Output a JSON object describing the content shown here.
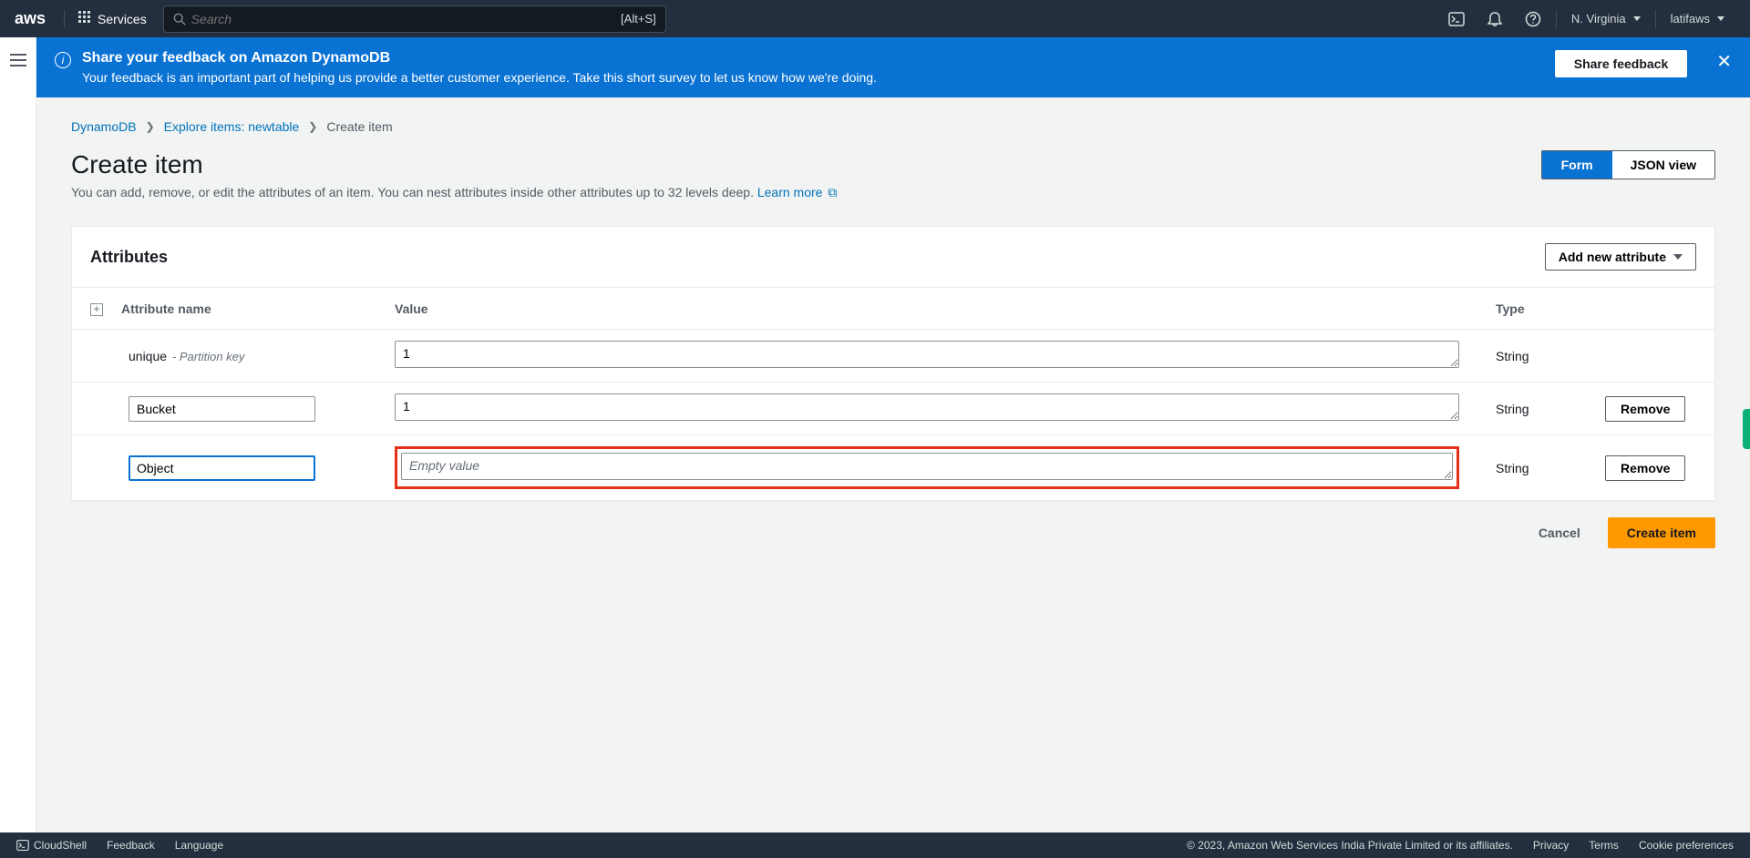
{
  "topnav": {
    "logo_text": "aws",
    "services_label": "Services",
    "search_placeholder": "Search",
    "search_shortcut": "[Alt+S]",
    "region": "N. Virginia",
    "account": "latifaws"
  },
  "banner": {
    "title": "Share your feedback on Amazon DynamoDB",
    "desc": "Your feedback is an important part of helping us provide a better customer experience. Take this short survey to let us know how we're doing.",
    "button": "Share feedback"
  },
  "breadcrumb": {
    "items": [
      "DynamoDB",
      "Explore items: newtable",
      "Create item"
    ]
  },
  "page": {
    "title": "Create item",
    "desc_prefix": "You can add, remove, or edit the attributes of an item. You can nest attributes inside other attributes up to 32 levels deep. ",
    "learn_more": "Learn more",
    "toggle_form": "Form",
    "toggle_json": "JSON view"
  },
  "panel": {
    "title": "Attributes",
    "add_button": "Add new attribute",
    "headers": {
      "name": "Attribute name",
      "value": "Value",
      "type": "Type"
    },
    "rows": [
      {
        "name": "unique",
        "name_suffix": "- Partition key",
        "name_editable": false,
        "value": "1",
        "placeholder": "",
        "type": "String",
        "removable": false,
        "highlight": false
      },
      {
        "name": "Bucket",
        "name_suffix": "",
        "name_editable": true,
        "value": "1",
        "placeholder": "",
        "type": "String",
        "removable": true,
        "highlight": false
      },
      {
        "name": "Object",
        "name_suffix": "",
        "name_editable": true,
        "name_focused": true,
        "value": "",
        "placeholder": "Empty value",
        "type": "String",
        "removable": true,
        "highlight": true
      }
    ],
    "remove_label": "Remove"
  },
  "actions": {
    "cancel": "Cancel",
    "create": "Create item"
  },
  "footer": {
    "cloudshell": "CloudShell",
    "feedback": "Feedback",
    "language": "Language",
    "copyright": "© 2023, Amazon Web Services India Private Limited or its affiliates.",
    "privacy": "Privacy",
    "terms": "Terms",
    "cookies": "Cookie preferences"
  }
}
